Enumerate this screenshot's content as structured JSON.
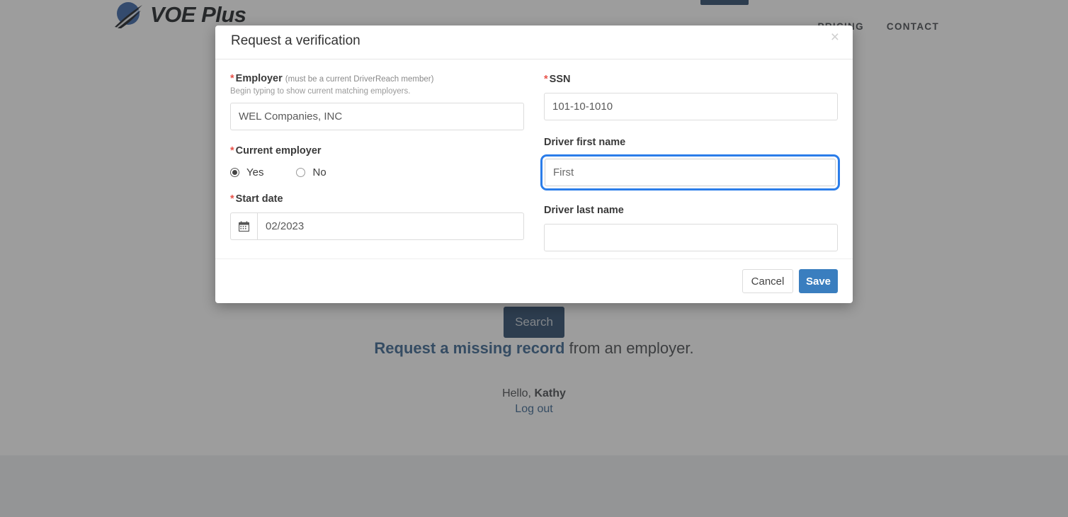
{
  "site": {
    "brand_name": "VOE Plus",
    "brand_icon": "swoosh-road-logo-icon",
    "nav": [
      {
        "label": "PRICING"
      },
      {
        "label": "CONTACT"
      }
    ],
    "header_cta_label": ""
  },
  "page": {
    "search_button_label": "Search",
    "missing_record_link": "Request a missing record",
    "missing_record_rest": " from an employer.",
    "greeting_prefix": "Hello, ",
    "greeting_name": "Kathy",
    "logout_label": "Log out"
  },
  "modal": {
    "title": "Request a verification",
    "close_icon": "×",
    "left_column": {
      "employer": {
        "required_marker": "*",
        "label": "Employer",
        "label_note": "(must be a current DriverReach member)",
        "help_text": "Begin typing to show current matching employers.",
        "value": "WEL Companies, INC",
        "placeholder": ""
      },
      "current_employer": {
        "required_marker": "*",
        "label": "Current employer",
        "options": [
          {
            "label": "Yes",
            "selected": true
          },
          {
            "label": "No",
            "selected": false
          }
        ]
      },
      "start_date": {
        "required_marker": "*",
        "label": "Start date",
        "icon": "calendar-icon",
        "value": "02/2023",
        "placeholder": ""
      }
    },
    "right_column": {
      "ssn": {
        "required_marker": "*",
        "label": "SSN",
        "value": "101-10-1010",
        "placeholder": ""
      },
      "driver_first_name": {
        "label": "Driver first name",
        "value": "First",
        "placeholder": "",
        "focused": true
      },
      "driver_last_name": {
        "label": "Driver last name",
        "value": "",
        "placeholder": ""
      }
    },
    "footer": {
      "cancel_label": "Cancel",
      "save_label": "Save"
    }
  },
  "colors": {
    "primary_navy": "#1e3f63",
    "save_blue": "#3a7ebf",
    "link_blue": "#2e5c8a",
    "focus_ring": "#2b7de9",
    "required_red": "#e8534a",
    "backdrop": "rgba(60,60,60,0.5)"
  }
}
